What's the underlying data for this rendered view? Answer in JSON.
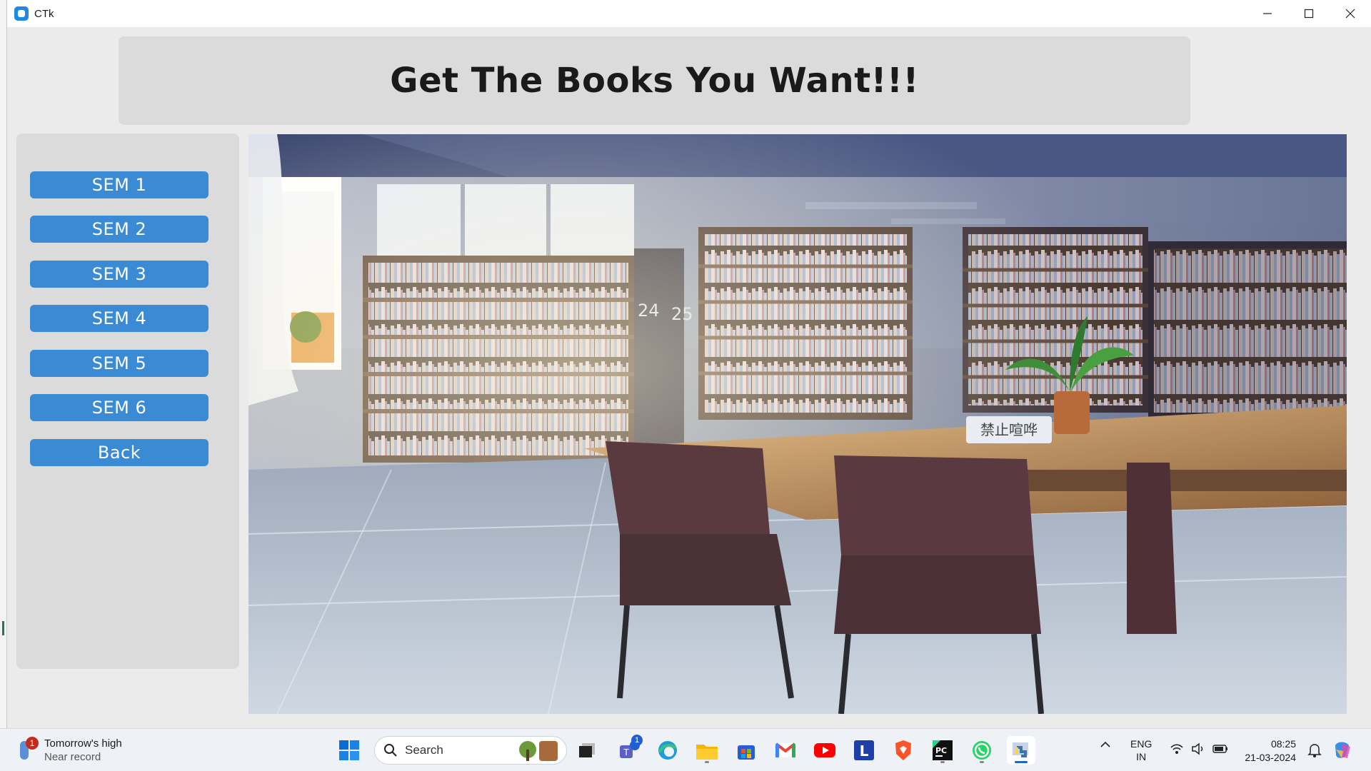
{
  "window": {
    "title": "CTk"
  },
  "header": {
    "title": "Get The Books You Want!!!"
  },
  "sidebar": {
    "buttons": [
      {
        "label": "SEM 1"
      },
      {
        "label": "SEM 2"
      },
      {
        "label": "SEM 3"
      },
      {
        "label": "SEM 4"
      },
      {
        "label": "SEM 5"
      },
      {
        "label": "SEM 6"
      },
      {
        "label": "Back"
      }
    ]
  },
  "image": {
    "sign_text": "禁止喧哗",
    "shelf_numbers": [
      "24",
      "25"
    ]
  },
  "colors": {
    "button": "#3a8ad4",
    "frame": "#dbdbdb",
    "window_bg": "#ebebeb"
  },
  "taskbar": {
    "weather": {
      "line1": "Tomorrow's high",
      "line2": "Near record",
      "badge": "1"
    },
    "search_placeholder": "Search",
    "teams_badge": "1",
    "language": {
      "line1": "ENG",
      "line2": "IN"
    },
    "clock": {
      "time": "08:25",
      "date": "21-03-2024"
    },
    "apps": [
      "start-icon",
      "search-icon",
      "task-view-icon",
      "teams-icon",
      "edge-icon",
      "file-explorer-icon",
      "store-icon",
      "gmail-icon",
      "youtube-icon",
      "l-app-icon",
      "brave-icon",
      "pycharm-icon",
      "whatsapp-icon",
      "python-icon",
      "copilot-icon"
    ]
  }
}
